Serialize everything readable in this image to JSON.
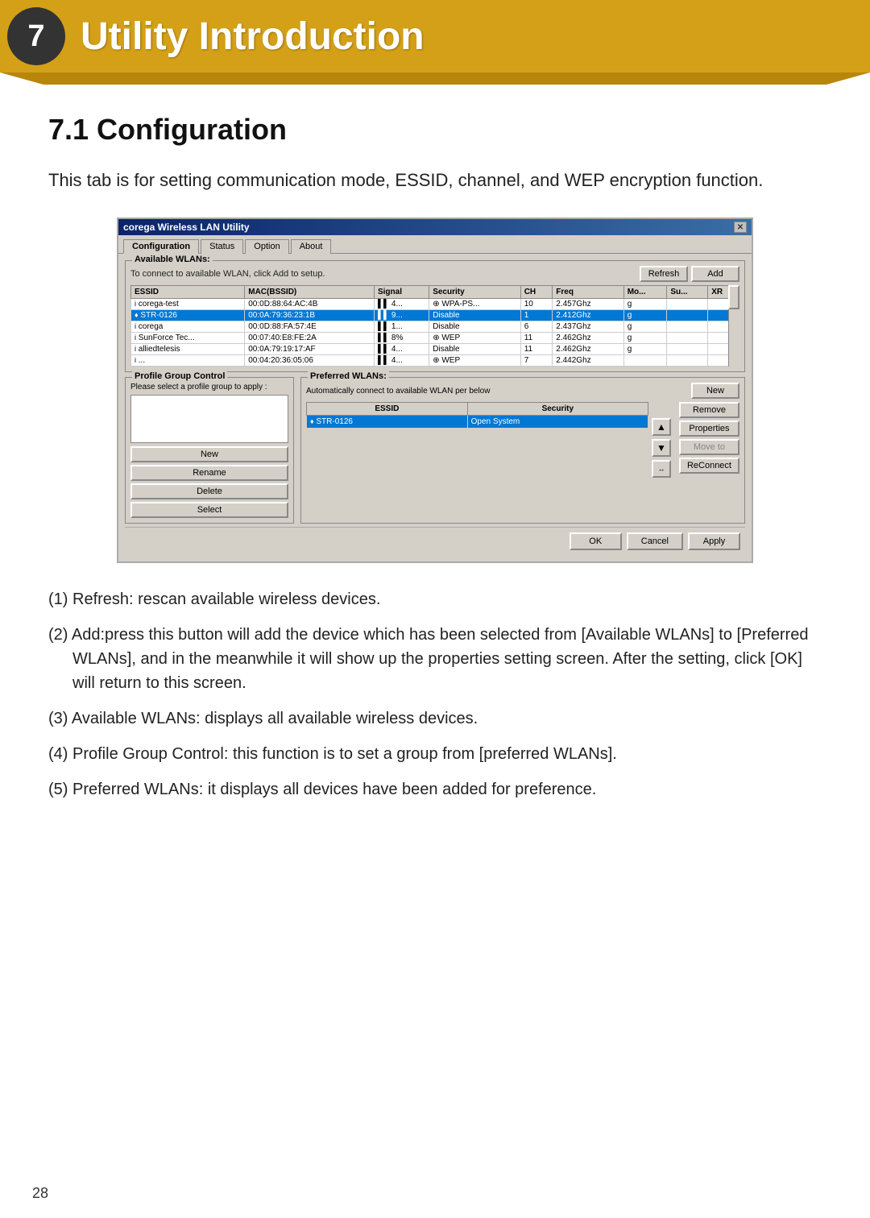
{
  "header": {
    "number": "7",
    "title": "Utility Introduction"
  },
  "section": {
    "title": "7.1 Configuration",
    "intro": "This tab is for setting communication mode, ESSID, channel, and WEP encryption function."
  },
  "dialog": {
    "title": "corega Wireless LAN Utility",
    "tabs": [
      "Configuration",
      "Status",
      "Option",
      "About"
    ],
    "active_tab": "Configuration",
    "available_wlans": {
      "label": "Available WLANs:",
      "description": "To connect to available WLAN, click Add to setup.",
      "refresh_btn": "Refresh",
      "add_btn": "Add",
      "columns": [
        "ESSID",
        "MAC(BSSID)",
        "Signal",
        "Security",
        "CH",
        "Freq",
        "Mo...",
        "Su...",
        "XR"
      ],
      "rows": [
        {
          "essid": "corega-test",
          "mac": "00:0D:88:64:AC:4B",
          "signal": "▌▌ 4...",
          "encrypt": "⊕ WPA-PS...",
          "ch": "10",
          "freq": "2.457Ghz",
          "mo": "g",
          "su": "",
          "xr": ""
        },
        {
          "essid": "STR-0126",
          "mac": "00:0A:79:36:23:1B",
          "signal": "▌▌ 9...",
          "encrypt": "Disable",
          "ch": "1",
          "freq": "2.412Ghz",
          "mo": "g",
          "su": "",
          "xr": "",
          "selected": true
        },
        {
          "essid": "corega",
          "mac": "00:0D:88:FA:57:4E",
          "signal": "▌▌ 1...",
          "encrypt": "Disable",
          "ch": "6",
          "freq": "2.437Ghz",
          "mo": "g",
          "su": "",
          "xr": ""
        },
        {
          "essid": "SunForce Tec...",
          "mac": "00:07:40:E8:FE:2A",
          "signal": "▌▌ 8%",
          "encrypt": "⊕ WEP",
          "ch": "11",
          "freq": "2.462Ghz",
          "mo": "g",
          "su": "",
          "xr": ""
        },
        {
          "essid": "alliedtelesis",
          "mac": "00:0A:79:19:17:AF",
          "signal": "▌▌ 4...",
          "encrypt": "Disable",
          "ch": "11",
          "freq": "2.462Ghz",
          "mo": "g",
          "su": "",
          "xr": ""
        },
        {
          "essid": "...",
          "mac": "00:04:20:36:05:06",
          "signal": "▌▌ 4...",
          "encrypt": "⊕ WEP",
          "ch": "7",
          "freq": "2.442Ghz",
          "mo": "",
          "su": "",
          "xr": ""
        }
      ]
    },
    "profile_group": {
      "label": "Profile Group Control",
      "description": "Please select a profile group to apply :",
      "buttons": [
        "New",
        "Rename",
        "Delete",
        "Select"
      ]
    },
    "preferred_wlans": {
      "label": "Preferred WLANs:",
      "description": "Automatically connect to available WLAN per below",
      "new_btn": "New",
      "remove_btn": "Remove",
      "properties_btn": "Properties",
      "moveto_btn": "Move to",
      "reconnect_btn": "ReConnect",
      "columns": [
        "ESSID",
        "Security"
      ],
      "rows": [
        {
          "essid": "STR-0126",
          "security": "Open System",
          "selected": true
        }
      ]
    },
    "footer": {
      "ok_btn": "OK",
      "cancel_btn": "Cancel",
      "apply_btn": "Apply"
    }
  },
  "descriptions": [
    {
      "num": "(1)",
      "text": "Refresh: rescan available wireless devices."
    },
    {
      "num": "(2)",
      "text": "Add:press this button will add the device which has been selected from [Available WLANs] to [Preferred WLANs], and in the meanwhile it will show up the properties setting screen. After the setting, click [OK] will return to this screen."
    },
    {
      "num": "(3)",
      "text": "Available WLANs: displays all available wireless devices."
    },
    {
      "num": "(4)",
      "text": "Profile Group Control: this function is to set a group from [preferred WLANs]."
    },
    {
      "num": "(5)",
      "text": "Preferred WLANs: it displays all devices have been added for preference."
    }
  ],
  "page_number": "28"
}
